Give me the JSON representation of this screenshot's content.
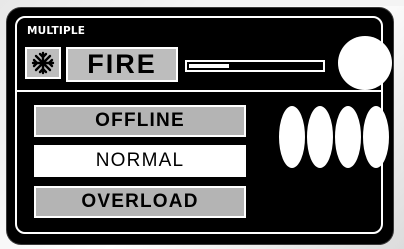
{
  "panel": {
    "title": "MULTIPLE",
    "fire_label": "FIRE",
    "snow_icon": "snowflake-icon",
    "level": 0.3,
    "status_light": "on"
  },
  "modes": [
    {
      "label": "OFFLINE",
      "selected": false
    },
    {
      "label": "NORMAL",
      "selected": true
    },
    {
      "label": "OVERLOAD",
      "selected": false
    }
  ],
  "channels": [
    {
      "id": 1,
      "icon": "pill-indicator"
    },
    {
      "id": 2,
      "icon": "pill-indicator"
    },
    {
      "id": 3,
      "icon": "pill-indicator"
    },
    {
      "id": 4,
      "icon": "pill-indicator"
    }
  ],
  "colors": {
    "panel": "#000000",
    "button": "#bdbdbd",
    "active": "#ffffff"
  }
}
